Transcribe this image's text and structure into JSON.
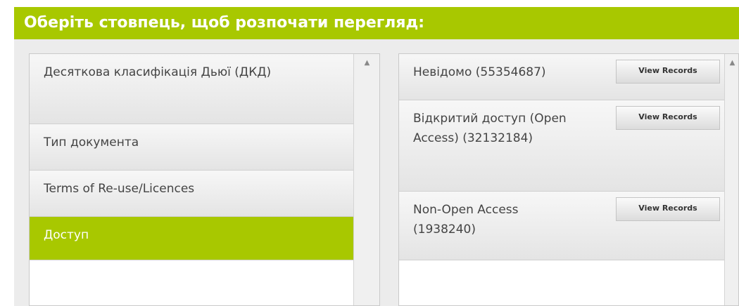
{
  "header": {
    "title": "Оберіть стовпець, щоб розпочати перегляд:"
  },
  "left_list": {
    "items": [
      {
        "label": "Десяткова класифікація Дьюї (ДКД)"
      },
      {
        "label": "Тип документа"
      },
      {
        "label": "Terms of Re-use/Licences"
      },
      {
        "label": "Доступ",
        "selected": true
      }
    ]
  },
  "right_list": {
    "items": [
      {
        "label": "Невідомо (55354687)",
        "button": "View Records"
      },
      {
        "label": "Відкритий доступ (Open Access) (32132184)",
        "button": "View Records"
      },
      {
        "label": "Non-Open Access (1938240)",
        "button": "View Records"
      }
    ]
  },
  "icons": {
    "scroll_up": "chevron-up-icon"
  },
  "colors": {
    "accent": "#a8c800",
    "item_text": "#444444",
    "panel_border": "#c9c9c9"
  }
}
